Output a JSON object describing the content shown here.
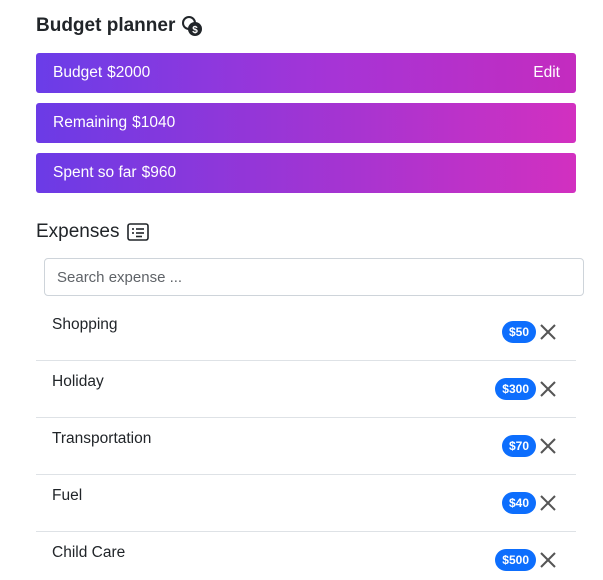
{
  "app": {
    "title": "Budget planner",
    "title_icon": "coins-icon"
  },
  "summary": {
    "budget_label": "Budget",
    "budget_value": "$2000",
    "edit_label": "Edit",
    "remaining_label": "Remaining",
    "remaining_value": "$1040",
    "spent_label": "Spent so far",
    "spent_value": "$960"
  },
  "expenses": {
    "title": "Expenses",
    "title_icon": "list-icon",
    "search_placeholder": "Search expense ...",
    "search_value": "",
    "items": [
      {
        "name": "Shopping",
        "cost": "$50"
      },
      {
        "name": "Holiday",
        "cost": "$300"
      },
      {
        "name": "Transportation",
        "cost": "$70"
      },
      {
        "name": "Fuel",
        "cost": "$40"
      },
      {
        "name": "Child Care",
        "cost": "$500"
      }
    ]
  },
  "colors": {
    "gradient_start": "#6a3de8",
    "gradient_end": "#d52fc0",
    "badge": "#0d6efd"
  }
}
